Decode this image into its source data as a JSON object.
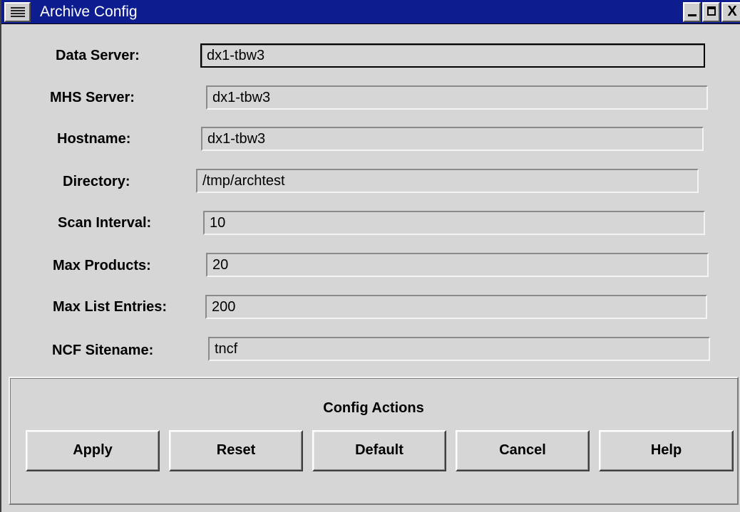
{
  "window": {
    "title": "Archive Config"
  },
  "form": {
    "fields": [
      {
        "label": "Data Server:",
        "value": "dx1-tbw3"
      },
      {
        "label": "MHS Server:",
        "value": "dx1-tbw3"
      },
      {
        "label": "Hostname:",
        "value": "dx1-tbw3"
      },
      {
        "label": "Directory:",
        "value": "/tmp/archtest"
      },
      {
        "label": "Scan Interval:",
        "value": "10"
      },
      {
        "label": "Max Products:",
        "value": "20"
      },
      {
        "label": "Max List Entries:",
        "value": "200"
      },
      {
        "label": "NCF Sitename:",
        "value": "tncf"
      }
    ]
  },
  "actions": {
    "title": "Config Actions",
    "buttons": {
      "apply": "Apply",
      "reset": "Reset",
      "default": "Default",
      "cancel": "Cancel",
      "help": "Help"
    }
  },
  "colors": {
    "titlebar": "#0d1d8f",
    "window_bg": "#d6d6d6"
  }
}
